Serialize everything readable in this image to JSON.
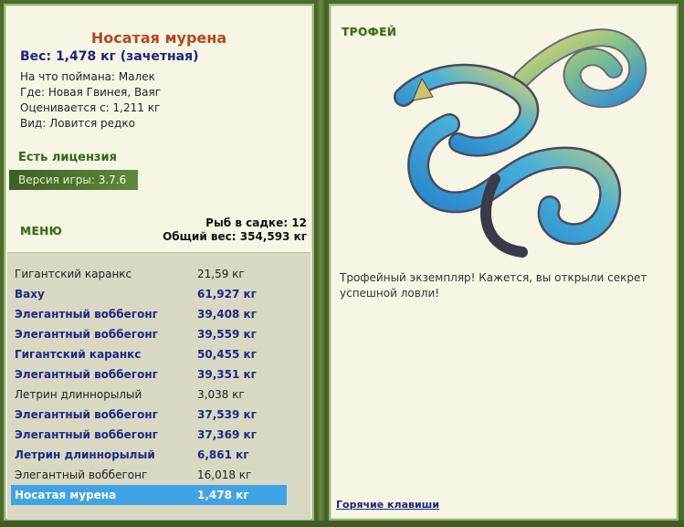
{
  "fish": {
    "title": "Носатая мурена",
    "weight": "Вес: 1,478 кг (зачетная)",
    "info": [
      "На что поймана: Малек",
      "Где: Новая Гвинея, Ваяг",
      "Оценивается с: 1,211 кг",
      "Вид: Ловится редко"
    ]
  },
  "license": "Есть лицензия",
  "version": {
    "label": "Версия игры: ",
    "value": "3.7.6"
  },
  "menu_label": "МЕНЮ",
  "keep": {
    "count": "Рыб в садке: 12",
    "total": "Общий вес: 354,593 кг"
  },
  "catch": [
    {
      "name": "Гигантский каранкс",
      "weight": "21,59 кг",
      "style": "plain"
    },
    {
      "name": "Ваху",
      "weight": "61,927 кг",
      "style": "trophy"
    },
    {
      "name": "Элегантный воббегонг",
      "weight": "39,408 кг",
      "style": "trophy"
    },
    {
      "name": "Элегантный воббегонг",
      "weight": "39,559 кг",
      "style": "trophy"
    },
    {
      "name": "Гигантский каранкс",
      "weight": "50,455 кг",
      "style": "trophy"
    },
    {
      "name": "Элегантный воббегонг",
      "weight": "39,351 кг",
      "style": "trophy"
    },
    {
      "name": "Летрин длиннорылый",
      "weight": "3,038 кг",
      "style": "plain"
    },
    {
      "name": "Элегантный воббегонг",
      "weight": "37,539 кг",
      "style": "trophy"
    },
    {
      "name": "Элегантный воббегонг",
      "weight": "37,369 кг",
      "style": "trophy"
    },
    {
      "name": "Летрин длиннорылый",
      "weight": "6,861 кг",
      "style": "trophy"
    },
    {
      "name": "Элегантный воббегонг",
      "weight": "16,018 кг",
      "style": "plain"
    },
    {
      "name": "Носатая мурена",
      "weight": "1,478 кг",
      "style": "selected"
    }
  ],
  "trophy": {
    "label": "ТРОФЕЙ",
    "text": "Трофейный экземпляр! Кажется, вы открыли секрет успешной ловли!"
  },
  "hotkeys": "Горячие клавиши",
  "colors": {
    "trophy_text": "#1b2a86",
    "selected_bg": "#3fa4e6",
    "title": "#b4471c",
    "frame_green": "#4a6b2c"
  }
}
